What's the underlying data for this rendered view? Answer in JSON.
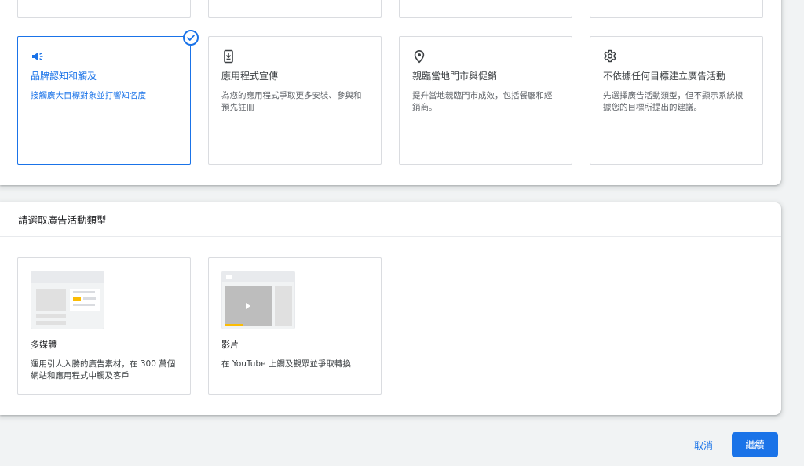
{
  "goals": [
    {
      "icon": "megaphone-icon",
      "title": "品牌認知和觸及",
      "description": "接觸廣大目標對象並打響知名度",
      "selected": true
    },
    {
      "icon": "phone-download-icon",
      "title": "應用程式宣傳",
      "description": "為您的應用程式爭取更多安裝、參與和預先註冊",
      "selected": false
    },
    {
      "icon": "location-pin-icon",
      "title": "親臨當地門市與促銷",
      "description": "提升當地親臨門市成效，包括餐廳和經銷商。",
      "selected": false
    },
    {
      "icon": "gear-icon",
      "title": "不依據任何目標建立廣告活動",
      "description": "先選擇廣告活動類型，但不顯示系統根據您的目標所提出的建議。",
      "selected": false
    }
  ],
  "campaign_type": {
    "heading": "請選取廣告活動類型",
    "types": [
      {
        "icon": "display-thumbnail",
        "title": "多媒體",
        "description": "運用引人入勝的廣告素材，在 300 萬個網站和應用程式中觸及客戶"
      },
      {
        "icon": "video-thumbnail",
        "title": "影片",
        "description": "在 YouTube 上觸及觀眾並爭取轉換"
      }
    ]
  },
  "actions": {
    "cancel_label": "取消",
    "continue_label": "繼續"
  },
  "colors": {
    "accent": "#1a73e8",
    "highlight": "#fbbc04"
  }
}
